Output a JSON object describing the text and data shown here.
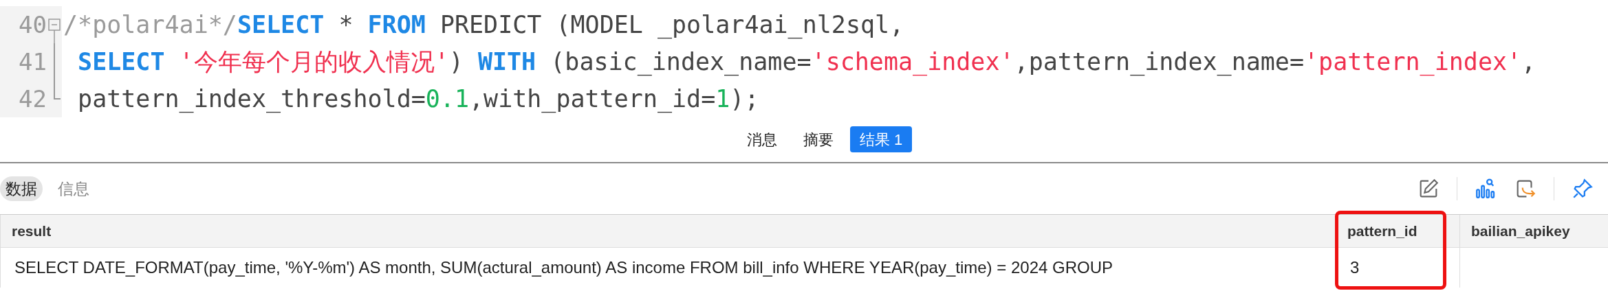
{
  "editor": {
    "lines": [
      {
        "number": "40",
        "kind": "fold_start",
        "tokens": [
          {
            "text": "/*polar4ai*/",
            "kind": "comment"
          },
          {
            "text": "SELECT",
            "kind": "keyword"
          },
          {
            "text": " * ",
            "kind": "plain"
          },
          {
            "text": "FROM",
            "kind": "keyword"
          },
          {
            "text": " PREDICT (MODEL _polar4ai_nl2sql,",
            "kind": "plain"
          }
        ]
      },
      {
        "number": "41",
        "kind": "fold_middle",
        "tokens": [
          {
            "text": " SELECT ",
            "kind": "keyword"
          },
          {
            "text": "'今年每个月的收入情况'",
            "kind": "string"
          },
          {
            "text": ") ",
            "kind": "plain"
          },
          {
            "text": "WITH",
            "kind": "keyword"
          },
          {
            "text": " (basic_index_name=",
            "kind": "plain"
          },
          {
            "text": "'schema_index'",
            "kind": "string"
          },
          {
            "text": ",pattern_index_name=",
            "kind": "plain"
          },
          {
            "text": "'pattern_index'",
            "kind": "string"
          },
          {
            "text": ",",
            "kind": "plain"
          }
        ]
      },
      {
        "number": "42",
        "kind": "fold_end",
        "tokens": [
          {
            "text": " pattern_index_threshold=",
            "kind": "plain"
          },
          {
            "text": "0.1",
            "kind": "number"
          },
          {
            "text": ",with_pattern_id=",
            "kind": "plain"
          },
          {
            "text": "1",
            "kind": "number"
          },
          {
            "text": ");",
            "kind": "plain"
          }
        ]
      }
    ]
  },
  "result_tabs": [
    {
      "label": "消息",
      "selected": false
    },
    {
      "label": "摘要",
      "selected": false
    },
    {
      "label": "结果 1",
      "selected": true
    }
  ],
  "view_tabs": [
    {
      "label": "数据",
      "selected": true
    },
    {
      "label": "信息",
      "selected": false
    }
  ],
  "table": {
    "columns": [
      {
        "label": "result",
        "highlighted": false
      },
      {
        "label": "pattern_id",
        "highlighted": true
      },
      {
        "label": "bailian_apikey",
        "highlighted": false
      }
    ],
    "rows": [
      [
        "SELECT DATE_FORMAT(pay_time, '%Y-%m') AS month, SUM(actural_amount) AS income FROM bill_info WHERE YEAR(pay_time) = 2024 GROUP",
        "3",
        ""
      ]
    ]
  }
}
